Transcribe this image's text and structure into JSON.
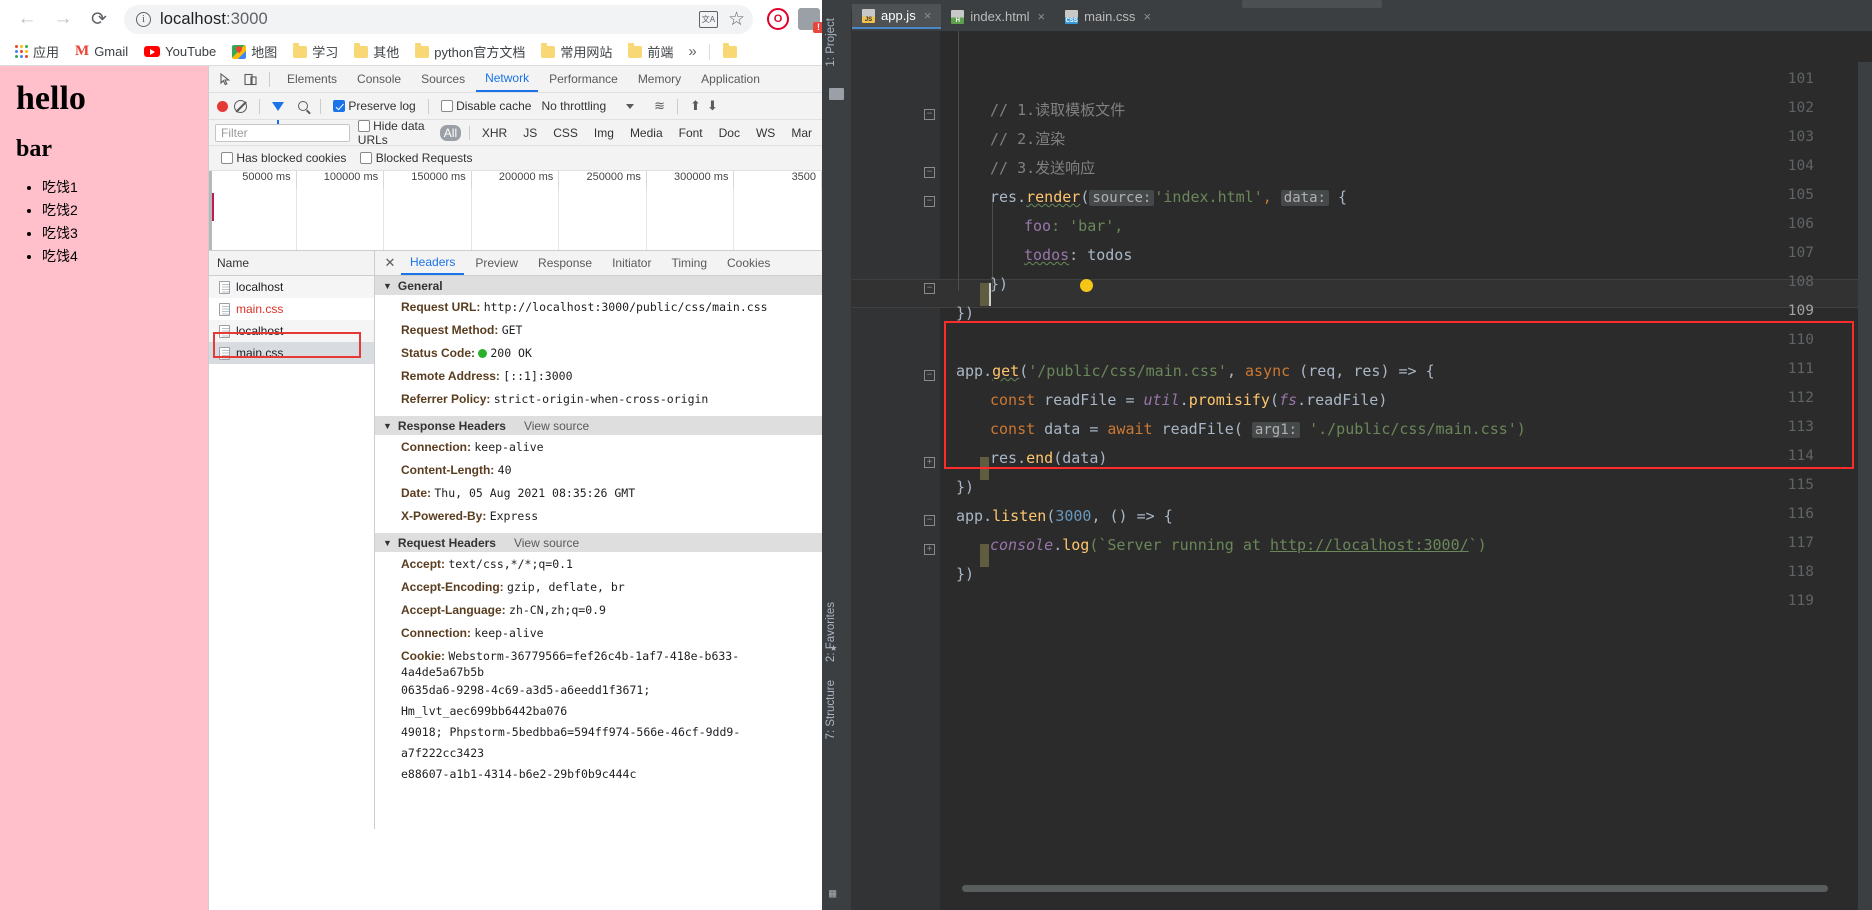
{
  "browser": {
    "nav": {
      "back": "←",
      "forward": "→",
      "reload": "⟳"
    },
    "omnibox": {
      "info_icon": "i",
      "url_host": "localhost",
      "url_port": ":3000",
      "translate_icon": "translate-icon",
      "star_icon": "☆"
    },
    "extensions": [
      {
        "name": "opera-extension-icon",
        "glyph": "O",
        "color": "#e0002a"
      },
      {
        "name": "shield-extension-icon",
        "glyph": "",
        "color": "#9aa0a6",
        "badge": "!"
      },
      {
        "name": "yandex-extension-icon",
        "glyph": "▼",
        "color": "#3b5fe0"
      },
      {
        "name": "adblock-extension-icon",
        "glyph": "▶",
        "color": "#e0002a"
      },
      {
        "name": "infinity-extension-icon",
        "glyph": "∞",
        "color": "#e8453c"
      },
      {
        "name": "blue-extension-icon",
        "glyph": "O",
        "color": "#29b6f6"
      },
      {
        "name": "sync-extension-icon",
        "glyph": "●",
        "color": "#1a73e8"
      }
    ],
    "bookmarks": [
      {
        "label": "应用",
        "icon": "apps-grid-icon"
      },
      {
        "label": "Gmail",
        "icon": "gmail-icon"
      },
      {
        "label": "YouTube",
        "icon": "youtube-icon"
      },
      {
        "label": "地图",
        "icon": "maps-icon"
      },
      {
        "label": "学习",
        "icon": "folder-icon"
      },
      {
        "label": "其他",
        "icon": "folder-icon"
      },
      {
        "label": "python官方文档",
        "icon": "folder-icon"
      },
      {
        "label": "常用网站",
        "icon": "folder-icon"
      },
      {
        "label": "前端",
        "icon": "folder-icon"
      }
    ],
    "bookmarks_overflow": "»",
    "bookmarks_extra": {
      "label": "",
      "icon": "folder-icon"
    }
  },
  "page": {
    "heading1": "hello",
    "heading2": "bar",
    "list": [
      "吃饯1",
      "吃饯2",
      "吃饯3",
      "吃饯4"
    ]
  },
  "devtools": {
    "inspect_icon": "cursor-inspect-icon",
    "device_icon": "device-toolbar-icon",
    "panels": [
      "Elements",
      "Console",
      "Sources",
      "Network",
      "Performance",
      "Memory",
      "Application"
    ],
    "active_panel": "Network",
    "panels_overflow": "Mar",
    "toolbar": {
      "record_icon": "record-icon",
      "clear_icon": "clear-icon",
      "filter_icon": "filter-icon",
      "search_icon": "search-icon",
      "preserve_log": "Preserve log",
      "preserve_log_checked": true,
      "disable_cache": "Disable cache",
      "disable_cache_checked": false,
      "throttling": "No throttling",
      "throttle_caret": "▼",
      "wifi_icon": "network-conditions-icon",
      "import_icon": "import-har-icon",
      "export_icon": "export-har-icon"
    },
    "filterbar": {
      "filter_placeholder": "Filter",
      "hide_data_urls": "Hide data URLs",
      "hide_data_urls_checked": false,
      "types": [
        "All",
        "XHR",
        "JS",
        "CSS",
        "Img",
        "Media",
        "Font",
        "Doc",
        "WS",
        "Mar"
      ],
      "active_type": "All"
    },
    "filterbar2": {
      "has_blocked_cookies": "Has blocked cookies",
      "has_blocked_cookies_checked": false,
      "blocked_requests": "Blocked Requests",
      "blocked_requests_checked": false
    },
    "overview_ticks": [
      "50000 ms",
      "100000 ms",
      "150000 ms",
      "200000 ms",
      "250000 ms",
      "300000 ms",
      "3500"
    ],
    "requests_header": "Name",
    "requests": [
      {
        "name": "localhost",
        "state": "normal"
      },
      {
        "name": "main.css",
        "state": "error"
      },
      {
        "name": "localhost",
        "state": "normal"
      },
      {
        "name": "main.css",
        "state": "selected"
      }
    ],
    "detail": {
      "close_icon": "close-icon",
      "tabs": [
        "Headers",
        "Preview",
        "Response",
        "Initiator",
        "Timing",
        "Cookies"
      ],
      "active_tab": "Headers",
      "sections": [
        {
          "title": "General",
          "view_source": "",
          "rows": [
            {
              "key": "Request URL:",
              "value": "http://localhost:3000/public/css/main.css"
            },
            {
              "key": "Request Method:",
              "value": "GET"
            },
            {
              "key": "Status Code:",
              "value": "200 OK",
              "status_dot": true
            },
            {
              "key": "Remote Address:",
              "value": "[::1]:3000"
            },
            {
              "key": "Referrer Policy:",
              "value": "strict-origin-when-cross-origin"
            }
          ]
        },
        {
          "title": "Response Headers",
          "view_source": "View source",
          "rows": [
            {
              "key": "Connection:",
              "value": "keep-alive"
            },
            {
              "key": "Content-Length:",
              "value": "40"
            },
            {
              "key": "Date:",
              "value": "Thu, 05 Aug 2021 08:35:26 GMT"
            },
            {
              "key": "X-Powered-By:",
              "value": "Express"
            }
          ]
        },
        {
          "title": "Request Headers",
          "view_source": "View source",
          "rows": [
            {
              "key": "Accept:",
              "value": "text/css,*/*;q=0.1"
            },
            {
              "key": "Accept-Encoding:",
              "value": "gzip, deflate, br"
            },
            {
              "key": "Accept-Language:",
              "value": "zh-CN,zh;q=0.9"
            },
            {
              "key": "Connection:",
              "value": "keep-alive"
            }
          ]
        }
      ],
      "cookie_key": "Cookie:",
      "cookie_lines": [
        "Webstorm-36779566=fef26c4b-1af7-418e-b633-4a4de5a67b5b",
        "0635da6-9298-4c69-a3d5-a6eedd1f3671; Hm_lvt_aec699bb6442ba076",
        "49018; Phpstorm-5bedbba6=594ff974-566e-46cf-9dd9-a7f222cc3423",
        "e88607-a1b1-4314-b6e2-29bf0b9c444c"
      ]
    }
  },
  "ide": {
    "rail_project": "1: Project",
    "rail_favorites": "2: Favorites",
    "rail_structure": "7: Structure",
    "tabs": [
      {
        "label": "app.js",
        "type": "js",
        "active": true,
        "close": "×"
      },
      {
        "label": "index.html",
        "type": "html",
        "active": false,
        "close": "×"
      },
      {
        "label": "main.css",
        "type": "css",
        "active": false,
        "close": "×"
      }
    ],
    "line_numbers": [
      "101",
      "102",
      "103",
      "104",
      "105",
      "106",
      "107",
      "108",
      "109",
      "110",
      "111",
      "112",
      "113",
      "114",
      "115",
      "116",
      "117",
      "118",
      "119"
    ],
    "current_line": "109",
    "code": {
      "l102": "// 1.读取模板文件",
      "l103": "// 2.渲染",
      "l104": "// 3.发送响应",
      "l105_a": "res.",
      "l105_b": "render",
      "l105_c": "(",
      "l105_hint": "source:",
      "l105_str": "'index.html'",
      "l105_d": ", ",
      "l105_hint2": "data:",
      "l105_e": " {",
      "l106_k": "foo",
      "l106_v": ": 'bar',",
      "l107_k": "todos",
      "l107_v": ": todos",
      "l108": "})",
      "l109": "})",
      "l111_a": "app.",
      "l111_b": "get",
      "l111_c": "(",
      "l111_str": "'/public/css/main.css'",
      "l111_d": ", ",
      "l111_kw": "async",
      "l111_e": " (req, res) => {",
      "l112_kw": "const",
      "l112_a": " readFile = ",
      "l112_mod": "util",
      "l112_b": ".",
      "l112_fn": "promisify",
      "l112_c": "(",
      "l112_fs": "fs",
      "l112_d": ".readFile)",
      "l113_kw": "const",
      "l113_a": " data = ",
      "l113_await": "await",
      "l113_b": " readFile( ",
      "l113_hint": "arg1:",
      "l113_str": " './public/css/main.css')",
      "l114_a": "res.",
      "l114_fn": "end",
      "l114_b": "(data)",
      "l115": "})",
      "l116_a": "app.",
      "l116_fn": "listen",
      "l116_b": "(",
      "l116_num": "3000",
      "l116_c": ", () => {",
      "l117_obj": "console",
      "l117_a": ".",
      "l117_fn": "log",
      "l117_b": "(`Server running at ",
      "l117_link": "http://localhost:3000/",
      "l117_c": "`)",
      "l118": "})"
    }
  },
  "colors": {
    "accent_blue": "#1a73e8",
    "page_bg": "#ffc0cb",
    "error_red": "#d93025",
    "highlight_red": "#ff2b2b",
    "ide_bg": "#2b2b2b",
    "status_green": "#2bb02b"
  }
}
